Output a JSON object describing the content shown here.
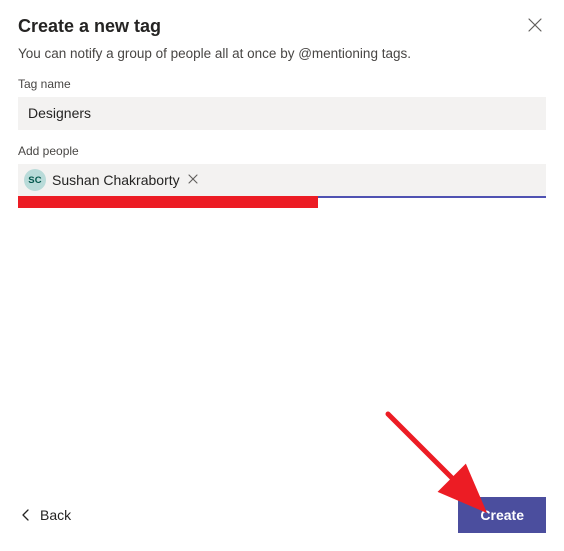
{
  "dialog": {
    "title": "Create a new tag",
    "subtitle": "You can notify a group of people all at once by @mentioning tags."
  },
  "tag_name": {
    "label": "Tag name",
    "value": "Designers"
  },
  "add_people": {
    "label": "Add people",
    "chips": [
      {
        "initials": "SC",
        "name": "Sushan Chakraborty"
      }
    ]
  },
  "footer": {
    "back_label": "Back",
    "create_label": "Create"
  },
  "colors": {
    "accent": "#4f52b2",
    "button": "#4b4e9e",
    "redaction": "#ec1c24",
    "annotation_arrow": "#ec1c24"
  }
}
